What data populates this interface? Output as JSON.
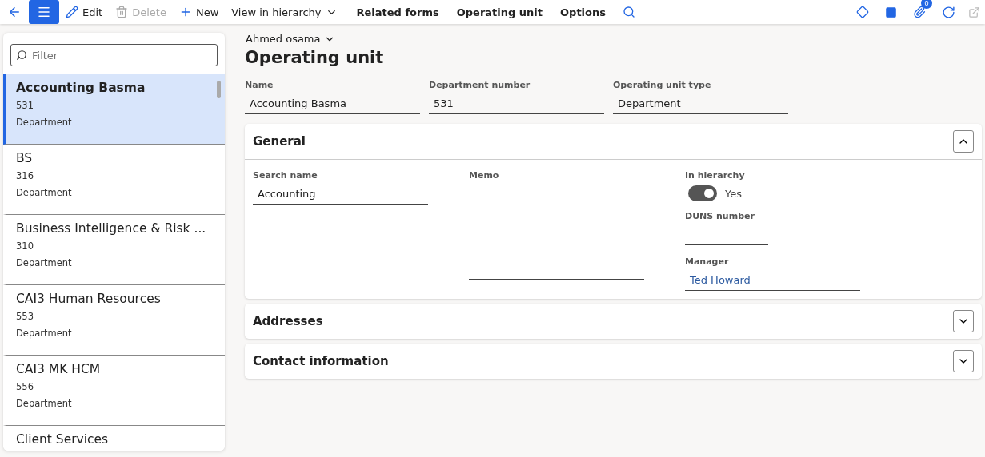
{
  "toolbar": {
    "buttons": [
      {
        "kind": "edit",
        "label": "Edit",
        "disabled": false
      },
      {
        "kind": "delete",
        "label": "Delete",
        "disabled": true
      },
      {
        "kind": "new",
        "label": "New",
        "disabled": false
      },
      {
        "kind": "dropdown",
        "label": "View in hierarchy",
        "disabled": false
      }
    ],
    "menus": [
      "Related forms",
      "Operating unit",
      "Options"
    ],
    "attachments_badge": "0"
  },
  "filter": {
    "placeholder": "Filter"
  },
  "list": [
    {
      "name": "Accounting Basma",
      "number": "531",
      "type": "Department",
      "selected": true
    },
    {
      "name": "BS",
      "number": "316",
      "type": "Department",
      "selected": false
    },
    {
      "name": "Business Intelligence & Risk ...",
      "number": "310",
      "type": "Department",
      "selected": false
    },
    {
      "name": "CAI3 Human Resources",
      "number": "553",
      "type": "Department",
      "selected": false
    },
    {
      "name": "CAI3 MK HCM",
      "number": "556",
      "type": "Department",
      "selected": false
    },
    {
      "name": "Client Services",
      "selected": false
    }
  ],
  "user": "Ahmed osama",
  "title": "Operating unit",
  "header_fields": [
    {
      "label": "Name",
      "value": "Accounting Basma"
    },
    {
      "label": "Department number",
      "value": "531"
    },
    {
      "label": "Operating unit type",
      "value": "Department"
    }
  ],
  "general": {
    "title": "General",
    "expanded": true,
    "search_name": {
      "label": "Search name",
      "value": "Accounting"
    },
    "memo": {
      "label": "Memo"
    },
    "in_hierarchy": {
      "label": "In hierarchy",
      "on": true,
      "text": "Yes"
    },
    "duns": {
      "label": "DUNS number"
    },
    "manager": {
      "label": "Manager",
      "value": "Ted Howard"
    }
  },
  "sections": [
    {
      "title": "Addresses",
      "expanded": false
    },
    {
      "title": "Contact information",
      "expanded": false
    }
  ]
}
